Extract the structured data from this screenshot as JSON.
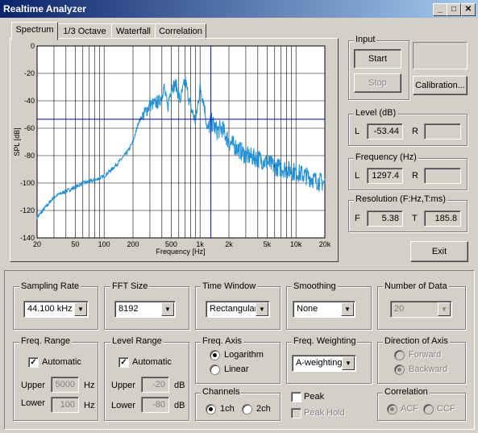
{
  "window": {
    "title": "Realtime Analyzer",
    "minimize": "_",
    "maximize": "□",
    "close": "✕"
  },
  "tabs": [
    "Spectrum",
    "1/3 Octave",
    "Waterfall",
    "Correlation"
  ],
  "chart_data": {
    "type": "line",
    "xlabel": "Frequency [Hz]",
    "ylabel": "SPL [dB]",
    "x_scale": "log",
    "xlim": [
      20,
      20000
    ],
    "ylim": [
      -140,
      0
    ],
    "x_ticks": [
      "20",
      "50",
      "100",
      "200",
      "500",
      "1k",
      "2k",
      "5k",
      "10k",
      "20k"
    ],
    "y_ticks": [
      "0",
      "-20",
      "-40",
      "-60",
      "-80",
      "-100",
      "-120",
      "-140"
    ],
    "grid": true,
    "cursor": {
      "x": 1297.4,
      "y": -53.44
    },
    "series": [
      {
        "x": [
          20,
          25,
          30,
          40,
          50,
          60,
          80,
          100,
          120,
          150,
          180,
          200,
          230,
          260,
          300,
          340,
          380,
          420,
          460,
          500,
          560,
          620,
          700,
          800,
          900,
          1000,
          1100,
          1200,
          1300,
          1500,
          1700,
          2000,
          2500,
          3000,
          4000,
          5000,
          6000,
          8000,
          10000,
          13000,
          16000,
          20000
        ],
        "y": [
          -125,
          -117,
          -110,
          -106,
          -103,
          -100,
          -98,
          -95,
          -90,
          -83,
          -76,
          -70,
          -55,
          -50,
          -43,
          -42,
          -40,
          -30,
          -45,
          -30,
          -28,
          -40,
          -25,
          -45,
          -55,
          -30,
          -42,
          -62,
          -55,
          -62,
          -60,
          -70,
          -75,
          -80,
          -82,
          -85,
          -88,
          -90,
          -92,
          -95,
          -98,
          -100
        ]
      }
    ]
  },
  "input": {
    "label": "Input",
    "start": "Start",
    "stop": "Stop",
    "calibration": "Calibration..."
  },
  "level": {
    "label": "Level (dB)",
    "l_label": "L",
    "l_value": "-53.44",
    "r_label": "R",
    "r_value": ""
  },
  "frequency": {
    "label": "Frequency (Hz)",
    "l_label": "L",
    "l_value": "1297.4",
    "r_label": "R",
    "r_value": ""
  },
  "resolution": {
    "label": "Resolution (F:Hz,T:ms)",
    "f_label": "F",
    "f_value": "5.38",
    "t_label": "T",
    "t_value": "185.8"
  },
  "exit": "Exit",
  "sampling_rate": {
    "label": "Sampling Rate",
    "value": "44.100 kHz"
  },
  "fft_size": {
    "label": "FFT Size",
    "value": "8192"
  },
  "time_window": {
    "label": "Time Window",
    "value": "Rectangular"
  },
  "smoothing": {
    "label": "Smoothing",
    "value": "None"
  },
  "number_of_data": {
    "label": "Number of Data",
    "value": "20"
  },
  "freq_range": {
    "label": "Freq. Range",
    "automatic": "Automatic",
    "upper_label": "Upper",
    "upper_value": "5000",
    "upper_unit": "Hz",
    "lower_label": "Lower",
    "lower_value": "100",
    "lower_unit": "Hz"
  },
  "level_range": {
    "label": "Level Range",
    "automatic": "Automatic",
    "upper_label": "Upper",
    "upper_value": "-20",
    "upper_unit": "dB",
    "lower_label": "Lower",
    "lower_value": "-80",
    "lower_unit": "dB"
  },
  "freq_axis": {
    "label": "Freq. Axis",
    "log": "Logarithm",
    "linear": "Linear"
  },
  "freq_weighting": {
    "label": "Freq. Weighting",
    "value": "A-weighting"
  },
  "direction": {
    "label": "Direction of Axis",
    "forward": "Forward",
    "backward": "Backward"
  },
  "channels": {
    "label": "Channels",
    "ch1": "1ch",
    "ch2": "2ch"
  },
  "peak": {
    "peak": "Peak",
    "peak_hold": "Peak Hold"
  },
  "correlation": {
    "label": "Correlation",
    "acf": "ACF",
    "ccf": "CCF"
  },
  "colors": {
    "trace": "#1e90d8",
    "cursor": "#0000c0",
    "titlebar": "#0a246a"
  }
}
